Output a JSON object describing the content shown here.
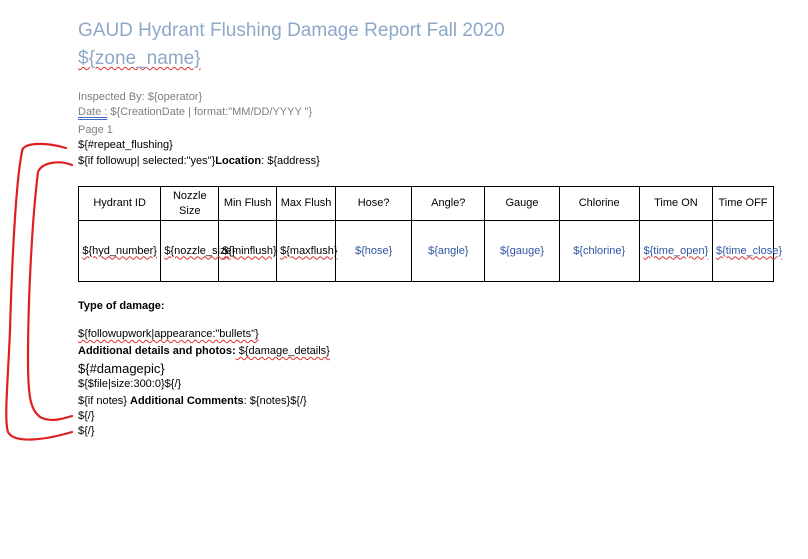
{
  "document": {
    "title": "GAUD Hydrant Flushing Damage Report Fall 2020",
    "subtitle": "${zone_name}",
    "inspected_by": "Inspected By: ${operator}",
    "date_label": "Date :",
    "date_value": " ${CreationDate | format:\"MM/DD/YYYY \"}",
    "page": "Page 1",
    "repeat_start": "${#repeat_flushing}",
    "followup_prefix": "${if followup| selected:\"yes\"}",
    "location_label": "Location",
    "location_value": ": ${address}"
  },
  "table": {
    "headers": [
      "Hydrant ID",
      "Nozzle Size",
      "Min Flush",
      "Max Flush",
      "Hose?",
      "Angle?",
      "Gauge",
      "Chlorine",
      "Time ON",
      "Time OFF"
    ],
    "row": [
      "${hyd_number}",
      "${nozzle_size}",
      "${minflush}",
      "${maxflush}",
      "${hose}",
      "${angle}",
      "${gauge}",
      "${chlorine}",
      "${time_open}",
      "${time_close}"
    ]
  },
  "details": {
    "type_of_damage": "Type of damage:",
    "followupwork": "${followupwork|appearance:\"bullets\"}",
    "additional_label": "Additional details and photos:",
    "additional_value": "  ${damage_details}",
    "damagepic": "${#damagepic}",
    "file": "${$file|size:300:0}${/}",
    "notes_prefix": "${if notes} ",
    "notes_label": "Additional Comments",
    "notes_value": ": ${notes}${/}",
    "close1": "${/}",
    "close2": "${/}"
  },
  "colors": {
    "title": "#8ea9c8",
    "bracket": "#e02020",
    "spellcheck": "#e03030",
    "field_blue": "#2f55a4"
  }
}
